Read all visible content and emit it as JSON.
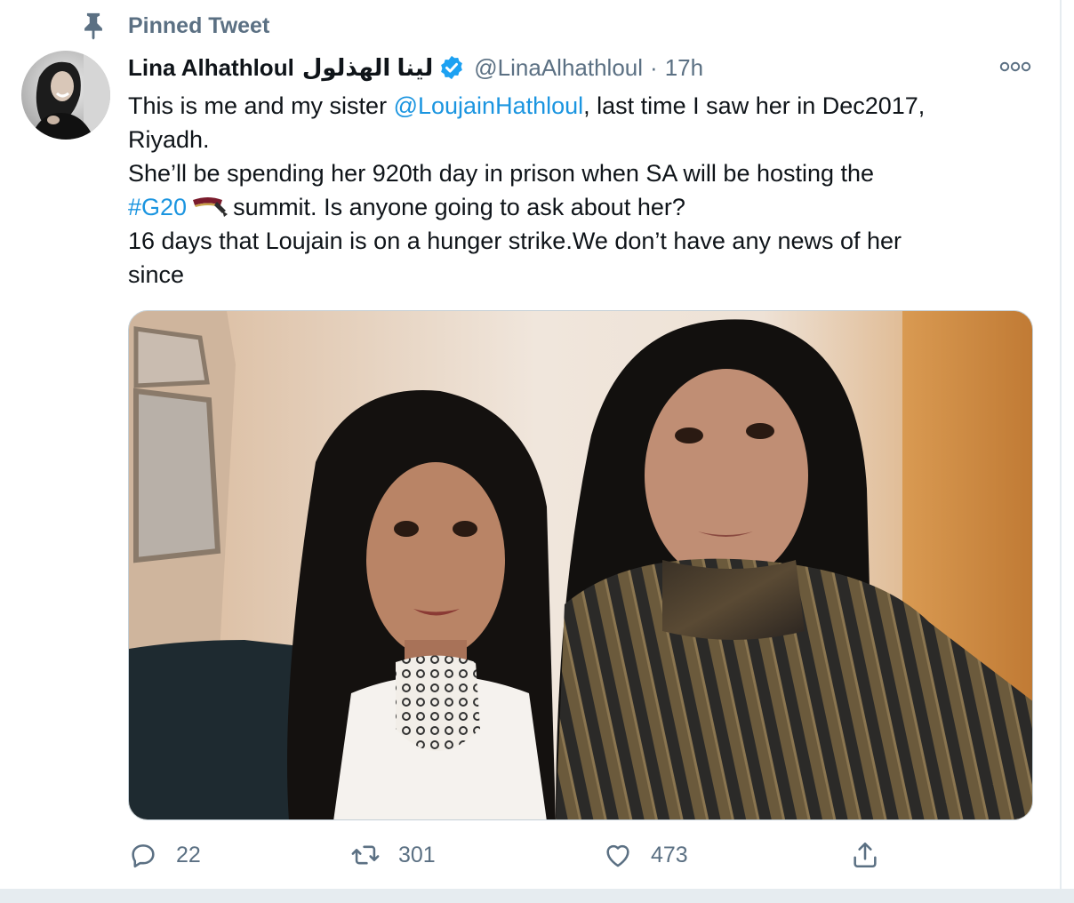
{
  "pinned": {
    "label": "Pinned Tweet",
    "icon": "pin-icon"
  },
  "author": {
    "name": "Lina Alhathloul",
    "name_arabic": "لينا الهذلول",
    "verified_icon": "verified-badge-icon",
    "handle": "@LinaAlhathloul",
    "separator": "·",
    "time": "17h"
  },
  "more_icon": "more-options-icon",
  "text": {
    "line1_pre": "This is me and my sister ",
    "mention": "@LoujainHathloul",
    "line1_post": ", last time I saw her in Dec2017,",
    "line2": "Riyadh.",
    "line3": "She’ll be spending her 920th day in prison when SA will be hosting the",
    "hashtag": "#G20",
    "hashtag_emoji": "g20-hashflag-icon",
    "line4_post": "summit. Is anyone going to ask about her?",
    "line5": "16 days that Loujain is on a hunger strike.We don’t have any news of her",
    "line6": "since"
  },
  "actions": {
    "reply": {
      "icon": "reply-icon",
      "count": "22"
    },
    "retweet": {
      "icon": "retweet-icon",
      "count": "301"
    },
    "like": {
      "icon": "heart-icon",
      "count": "473"
    },
    "share": {
      "icon": "share-icon"
    }
  },
  "colors": {
    "link": "#1b95e0",
    "secondary_text": "#5b7083",
    "verified": "#1da1f2",
    "divider": "#e6ecf0"
  }
}
